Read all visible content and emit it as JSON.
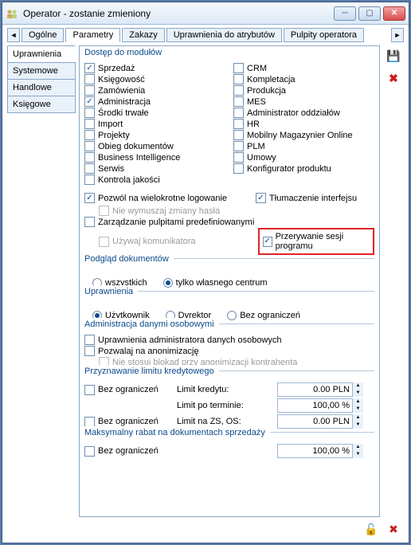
{
  "title": "Operator - zostanie zmieniony",
  "top_tabs": {
    "prev": "◄",
    "items": [
      "Ogólne",
      "Parametry",
      "Zakazy",
      "Uprawnienia do atrybutów",
      "Pulpity operatora"
    ],
    "active": 1,
    "next": "►"
  },
  "side_tabs": {
    "items": [
      "Uprawnienia",
      "Systemowe",
      "Handlowe",
      "Księgowe"
    ],
    "active": 0
  },
  "modules": {
    "title": "Dostęp do modułów",
    "left": [
      {
        "label": "Sprzedaż",
        "checked": true
      },
      {
        "label": "Księgowość",
        "checked": false
      },
      {
        "label": "Zamówienia",
        "checked": false
      },
      {
        "label": "Administracja",
        "checked": true
      },
      {
        "label": "Środki trwałe",
        "checked": false
      },
      {
        "label": "Import",
        "checked": false
      },
      {
        "label": "Projekty",
        "checked": false
      },
      {
        "label": "Obieg dokumentów",
        "checked": false
      },
      {
        "label": "Business Intelligence",
        "checked": false
      },
      {
        "label": "Serwis",
        "checked": false
      },
      {
        "label": "Kontrola jakości",
        "checked": false
      }
    ],
    "right": [
      {
        "label": "CRM",
        "checked": false
      },
      {
        "label": "Kompletacja",
        "checked": false
      },
      {
        "label": "Produkcja",
        "checked": false
      },
      {
        "label": "MES",
        "checked": false
      },
      {
        "label": "Administrator oddziałów",
        "checked": false
      },
      {
        "label": "HR",
        "checked": false
      },
      {
        "label": "Mobilny Magazynier Online",
        "checked": false
      },
      {
        "label": "PLM",
        "checked": false
      },
      {
        "label": "Umowy",
        "checked": false
      },
      {
        "label": "Konfigurator produktu",
        "checked": false
      }
    ]
  },
  "options": {
    "multi_login": {
      "label": "Pozwól na wielokrotne logowanie",
      "checked": true
    },
    "translate": {
      "label": "Tłumaczenie interfejsu",
      "checked": true
    },
    "no_force_pw": {
      "label": "Nie wymuszaj zmiany hasła",
      "checked": false,
      "disabled": true
    },
    "manage_desktops": {
      "label": "Zarządzanie pulpitami predefiniowanymi",
      "checked": false
    },
    "use_im": {
      "label": "Używaj komunikatora",
      "checked": false,
      "disabled": true
    },
    "interrupt_session": {
      "label": "Przerywanie sesji programu",
      "checked": true
    }
  },
  "doc_preview": {
    "title": "Podgląd dokumentów",
    "options": [
      "wszystkich",
      "tylko własnego centrum"
    ],
    "selected": 1
  },
  "perm": {
    "title": "Uprawnienia",
    "options": [
      "Użytkownik",
      "Dyrektor",
      "Bez ograniczeń"
    ],
    "selected": 0
  },
  "personal_data": {
    "title": "Administracja danymi osobowymi",
    "admin_perm": {
      "label": "Uprawnienia administratora danych osobowych",
      "checked": false
    },
    "allow_anon": {
      "label": "Pozwalaj na anonimizację",
      "checked": false
    },
    "no_blocks": {
      "label": "Nie stosuj blokad przy anonimizacji kontrahenta",
      "checked": false,
      "disabled": true
    }
  },
  "credit": {
    "title": "Przyznawanie limitu kredytowego",
    "unlimited1": {
      "label": "Bez ograniczeń",
      "checked": false
    },
    "limit_label": "Limit kredytu:",
    "limit_value": "0.00 PLN",
    "overdue_label": "Limit po terminie:",
    "overdue_value": "100,00 %",
    "unlimited2": {
      "label": "Bez ograniczeń",
      "checked": false
    },
    "zs_label": "Limit na ZS, OS:",
    "zs_value": "0.00 PLN"
  },
  "discount": {
    "title": "Maksymalny rabat na dokumentach sprzedaży",
    "unlimited": {
      "label": "Bez ograniczeń",
      "checked": false
    },
    "value": "100,00 %"
  },
  "icons": {
    "save": "💾",
    "delete": "✖",
    "lock": "🔓",
    "close": "✖"
  }
}
